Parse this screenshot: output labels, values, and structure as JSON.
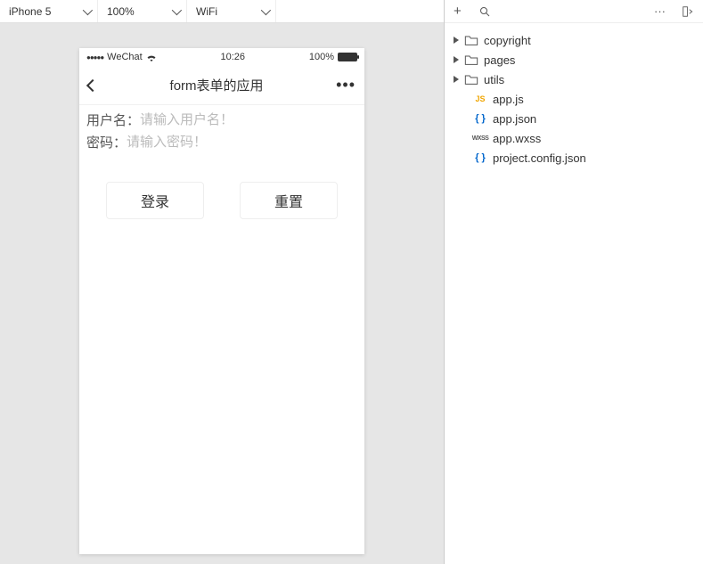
{
  "simulator": {
    "device": "iPhone 5",
    "zoom": "100%",
    "network": "WiFi"
  },
  "statusbar": {
    "carrier": "WeChat",
    "time": "10:26",
    "battery": "100%"
  },
  "navbar": {
    "title": "form表单的应用"
  },
  "form": {
    "username_label": "用户名：",
    "username_placeholder": "请输入用户名！",
    "password_label": "密码：",
    "password_placeholder": "请输入密码！",
    "login_btn": "登录",
    "reset_btn": "重置"
  },
  "tree": {
    "folders": [
      {
        "name": "copyright"
      },
      {
        "name": "pages"
      },
      {
        "name": "utils"
      }
    ],
    "files": [
      {
        "name": "app.js",
        "type": "js"
      },
      {
        "name": "app.json",
        "type": "json"
      },
      {
        "name": "app.wxss",
        "type": "wxss"
      },
      {
        "name": "project.config.json",
        "type": "json"
      }
    ]
  }
}
